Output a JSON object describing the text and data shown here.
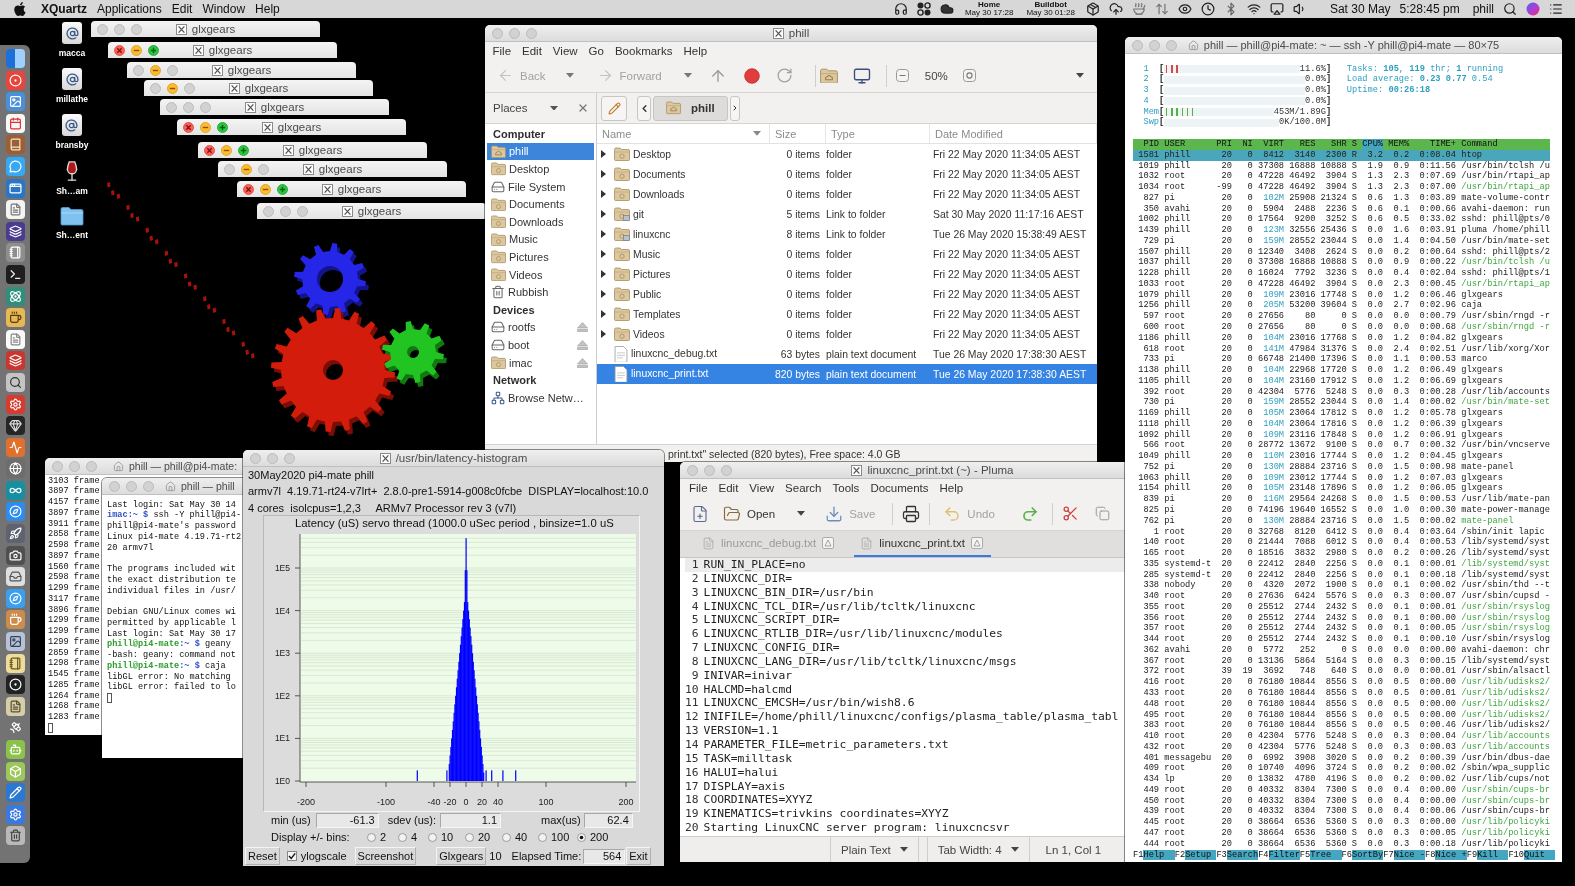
{
  "menubar": {
    "app": "XQuartz",
    "menus": [
      "Applications",
      "Edit",
      "Window",
      "Help"
    ],
    "clocks": [
      {
        "label": "Home",
        "time": "May 30 17:28"
      },
      {
        "label": "Buildbot",
        "time": "May 30 01:28"
      }
    ],
    "date": "Sat 30 May",
    "time": "5:28:45 pm",
    "user": "phill"
  },
  "desktop_icons": [
    {
      "label": "macca",
      "kind": "server"
    },
    {
      "label": "millathe",
      "kind": "server"
    },
    {
      "label": "bransby",
      "kind": "server"
    },
    {
      "label": "Sh…am",
      "kind": "wine"
    },
    {
      "label": "Sh…ent",
      "kind": "folder"
    }
  ],
  "glxgears_windows": [
    {
      "title": "glxgears",
      "lit": [
        false,
        false,
        false
      ]
    },
    {
      "title": "glxgears",
      "lit": [
        true,
        true,
        true
      ]
    },
    {
      "title": "glxgears",
      "lit": [
        false,
        true,
        false
      ]
    },
    {
      "title": "glxgears",
      "lit": [
        false,
        true,
        false
      ]
    },
    {
      "title": "glxgears",
      "lit": [
        false,
        false,
        false
      ]
    },
    {
      "title": "glxgears",
      "lit": [
        true,
        true,
        true
      ]
    },
    {
      "title": "glxgears",
      "lit": [
        true,
        true,
        true
      ]
    },
    {
      "title": "glxgears",
      "lit": [
        false,
        true,
        false
      ]
    },
    {
      "title": "glxgears",
      "lit": [
        true,
        true,
        true
      ]
    },
    {
      "title": "glxgears",
      "lit": [
        false,
        false,
        false
      ]
    }
  ],
  "file_manager": {
    "title": "phill",
    "menus": [
      "File",
      "Edit",
      "View",
      "Go",
      "Bookmarks",
      "Help"
    ],
    "back": {
      "label": "Back",
      "disabled": true
    },
    "forward": {
      "label": "Forward",
      "disabled": true
    },
    "zoom": "50%",
    "places": "Places",
    "path": "phill",
    "sidebar": [
      {
        "heading": "Computer",
        "items": [
          {
            "label": "phill",
            "kind": "home",
            "selected": true
          },
          {
            "label": "Desktop",
            "kind": "folder",
            "selected": false
          },
          {
            "label": "File System",
            "kind": "drive",
            "selected": false
          },
          {
            "label": "Documents",
            "kind": "folder",
            "selected": false
          },
          {
            "label": "Downloads",
            "kind": "folder",
            "selected": false
          },
          {
            "label": "Music",
            "kind": "folder",
            "selected": false
          },
          {
            "label": "Pictures",
            "kind": "folder",
            "selected": false
          },
          {
            "label": "Videos",
            "kind": "folder",
            "selected": false
          },
          {
            "label": "Rubbish",
            "kind": "trash",
            "selected": false
          }
        ]
      },
      {
        "heading": "Devices",
        "items": [
          {
            "label": "rootfs",
            "kind": "drive",
            "eject": true,
            "selected": false
          },
          {
            "label": "boot",
            "kind": "drive",
            "eject": true,
            "selected": false
          },
          {
            "label": "imac",
            "kind": "folder",
            "eject": true,
            "selected": false
          }
        ]
      },
      {
        "heading": "Network",
        "items": [
          {
            "label": "Browse Netw…",
            "kind": "network",
            "selected": false
          }
        ]
      }
    ],
    "columns": [
      {
        "label": "Name",
        "sorted": true
      },
      {
        "label": "Size",
        "sorted": false
      },
      {
        "label": "Type",
        "sorted": false
      },
      {
        "label": "Date Modified",
        "sorted": false
      }
    ],
    "files": [
      {
        "name": "Desktop",
        "size": "0 items",
        "type": "folder",
        "modified": "Fri 22 May 2020 11:34:05 AEST",
        "kind": "folder",
        "expandable": true,
        "selected": false
      },
      {
        "name": "Documents",
        "size": "0 items",
        "type": "folder",
        "modified": "Fri 22 May 2020 11:34:05 AEST",
        "kind": "folder",
        "expandable": true,
        "selected": false
      },
      {
        "name": "Downloads",
        "size": "0 items",
        "type": "folder",
        "modified": "Fri 22 May 2020 11:34:05 AEST",
        "kind": "folder",
        "expandable": true,
        "selected": false
      },
      {
        "name": "git",
        "size": "5 items",
        "type": "Link to folder",
        "modified": "Sat 30 May 2020 11:17:16 AEST",
        "kind": "link",
        "expandable": true,
        "selected": false
      },
      {
        "name": "linuxcnc",
        "size": "8 items",
        "type": "Link to folder",
        "modified": "Tue 26 May 2020 15:38:49 AEST",
        "kind": "link",
        "expandable": true,
        "selected": false
      },
      {
        "name": "Music",
        "size": "0 items",
        "type": "folder",
        "modified": "Fri 22 May 2020 11:34:05 AEST",
        "kind": "folder",
        "expandable": true,
        "selected": false
      },
      {
        "name": "Pictures",
        "size": "0 items",
        "type": "folder",
        "modified": "Fri 22 May 2020 11:34:05 AEST",
        "kind": "folder",
        "expandable": true,
        "selected": false
      },
      {
        "name": "Public",
        "size": "0 items",
        "type": "folder",
        "modified": "Fri 22 May 2020 11:34:05 AEST",
        "kind": "folder",
        "expandable": true,
        "selected": false
      },
      {
        "name": "Templates",
        "size": "0 items",
        "type": "folder",
        "modified": "Fri 22 May 2020 11:34:05 AEST",
        "kind": "folder",
        "expandable": true,
        "selected": false
      },
      {
        "name": "Videos",
        "size": "0 items",
        "type": "folder",
        "modified": "Fri 22 May 2020 11:34:05 AEST",
        "kind": "folder",
        "expandable": true,
        "selected": false
      },
      {
        "name": "linuxcnc_debug.txt",
        "size": "63 bytes",
        "type": "plain text document",
        "modified": "Tue 26 May 2020 17:38:30 AEST",
        "kind": "text",
        "expandable": false,
        "selected": false
      },
      {
        "name": "linuxcnc_print.txt",
        "size": "820 bytes",
        "type": "plain text document",
        "modified": "Tue 26 May 2020 17:38:30 AEST",
        "kind": "text",
        "expandable": false,
        "selected": true
      }
    ],
    "status": "print.txt\" selected (820 bytes), Free space: 4.0 GB"
  },
  "terminals": [
    {
      "title": "phill — phill@pi4-mate:",
      "blocks": [
        [
          {
            "text": "3103 frame"
          },
          {
            "text": "3897 frame"
          },
          {
            "text": "4157 frame"
          },
          {
            "text": "3897 frame"
          },
          {
            "text": "3911 frame"
          },
          {
            "text": "2858 frame"
          },
          {
            "text": "2598 frame"
          },
          {
            "text": "3897 frame"
          },
          {
            "text": "1560 frame"
          },
          {
            "text": "2598 frame"
          },
          {
            "text": "1299 frame"
          },
          {
            "text": "3117 frame"
          },
          {
            "text": "3896 frame"
          },
          {
            "text": "1299 frame"
          },
          {
            "text": "1299 frame"
          },
          {
            "text": "1299 frame"
          },
          {
            "text": "2859 frame"
          },
          {
            "text": "1298 frame"
          },
          {
            "text": "1545 frame"
          },
          {
            "text": "1285 frame"
          },
          {
            "text": "1264 frame"
          },
          {
            "text": "1268 frame"
          },
          {
            "text": "1283 frame"
          }
        ]
      ]
    },
    {
      "title": "phill — phill",
      "blocks": [
        [
          {
            "text": "Last login: Sat May 30 14"
          },
          {
            "prompt": "imac:~ $ ",
            "text": "ssh -Y phill@pi4-"
          },
          {
            "text": "phill@pi4-mate's password"
          },
          {
            "text": "Linux pi4-mate 4.19.71-rt2"
          },
          {
            "text": "20 armv7l"
          }
        ],
        [
          {
            "text": "The programs included wit"
          },
          {
            "text": "the exact distribution te"
          },
          {
            "text": "individual files in /usr/"
          }
        ],
        [
          {
            "text": "Debian GNU/Linux comes wi"
          },
          {
            "text": "permitted by applicable l"
          },
          {
            "text": "Last login: Sat May 30 17"
          },
          {
            "user": "phill@pi4-mate",
            "prompt": ":~ $ ",
            "text": "geany"
          },
          {
            "text": "-bash: geany: command not"
          },
          {
            "user": "phill@pi4-mate",
            "prompt": ":~ $ ",
            "text": "caja"
          },
          {
            "text": "libGL error: No matching"
          },
          {
            "text": "libGL error: failed to lo"
          }
        ]
      ]
    }
  ],
  "latency": {
    "title": "/usr/bin/latency-histogram",
    "info": [
      "30May2020 pi4-mate phill",
      "armv7l  4.19.71-rt24-v7lrt+  2.8.0-pre1-5914-g008c0fcbe  DISPLAY=localhost:10.0",
      "4 cores  isolcpus=1,2,3     ARMv7 Processor rev 3 (v7l)"
    ],
    "chart": {
      "title": "Latency (uS) servo thread (1000.0 uSec period , binsize=1.0 uS",
      "y_labels": [
        "1E5",
        "1E4",
        "1E3",
        "1E2",
        "1E1",
        "1E0"
      ],
      "x_labels": [
        "-200",
        "-100",
        "-40",
        "-20",
        "0",
        "20",
        "40",
        "100",
        "200"
      ]
    },
    "stats": [
      {
        "label": "min (us)",
        "value": "-61.3"
      },
      {
        "label": "sdev (us):",
        "value": "1.1"
      },
      {
        "label": "max(us)",
        "value": "62.4"
      }
    ],
    "bins": {
      "label": "Display +/- bins:",
      "options": [
        {
          "label": "2",
          "selected": false
        },
        {
          "label": "4",
          "selected": false
        },
        {
          "label": "10",
          "selected": false
        },
        {
          "label": "20",
          "selected": false
        },
        {
          "label": "40",
          "selected": false
        },
        {
          "label": "100",
          "selected": false
        },
        {
          "label": "200",
          "selected": true
        }
      ]
    },
    "controls_row": [
      {
        "kind": "button",
        "label": "Reset"
      },
      {
        "kind": "checkbox",
        "label": "ylogscale",
        "checked": true
      },
      {
        "kind": "button",
        "label": "Screenshot"
      },
      {
        "kind": "button",
        "label": "Glxgears"
      },
      {
        "kind": "text",
        "label": "10"
      },
      {
        "kind": "text",
        "label": "Elapsed Time:"
      },
      {
        "kind": "field",
        "label": "564"
      },
      {
        "kind": "button",
        "label": "Exit"
      }
    ]
  },
  "pluma": {
    "title": "linuxcnc_print.txt (~) - Pluma",
    "menus": [
      "File",
      "Edit",
      "View",
      "Search",
      "Tools",
      "Documents",
      "Help"
    ],
    "toolbar": {
      "open": {
        "label": "Open",
        "disabled": false
      },
      "save": {
        "label": "Save",
        "disabled": true
      },
      "undo": {
        "label": "Undo",
        "disabled": true
      }
    },
    "tabs": [
      {
        "label": "linuxcnc_debug.txt",
        "selected": false
      },
      {
        "label": "linuxcnc_print.txt",
        "selected": true
      }
    ],
    "lines": [
      {
        "number": "1",
        "text": "RUN_IN_PLACE=no",
        "current": true
      },
      {
        "number": "2",
        "text": "LINUXCNC_DIR=",
        "current": false
      },
      {
        "number": "3",
        "text": "LINUXCNC_BIN_DIR=/usr/bin",
        "current": false
      },
      {
        "number": "4",
        "text": "LINUXCNC_TCL_DIR=/usr/lib/tcltk/linuxcnc",
        "current": false
      },
      {
        "number": "5",
        "text": "LINUXCNC_SCRIPT_DIR=",
        "current": false
      },
      {
        "number": "6",
        "text": "LINUXCNC_RTLIB_DIR=/usr/lib/linuxcnc/modules",
        "current": false
      },
      {
        "number": "7",
        "text": "LINUXCNC_CONFIG_DIR=",
        "current": false
      },
      {
        "number": "8",
        "text": "LINUXCNC_LANG_DIR=/usr/lib/tcltk/linuxcnc/msgs",
        "current": false
      },
      {
        "number": "9",
        "text": "INIVAR=inivar",
        "current": false
      },
      {
        "number": "10",
        "text": "HALCMD=halcmd",
        "current": false
      },
      {
        "number": "11",
        "text": "LINUXCNC_EMCSH=/usr/bin/wish8.6",
        "current": false
      },
      {
        "number": "12",
        "text": "INIFILE=/home/phill/linuxcnc/configs/plasma_table/plasma_tabl",
        "current": false
      },
      {
        "number": "13",
        "text": "VERSION=1.1",
        "current": false
      },
      {
        "number": "14",
        "text": "PARAMETER_FILE=metric_parameters.txt",
        "current": false
      },
      {
        "number": "15",
        "text": "TASK=milltask",
        "current": false
      },
      {
        "number": "16",
        "text": "HALUI=halui",
        "current": false
      },
      {
        "number": "17",
        "text": "DISPLAY=axis",
        "current": false
      },
      {
        "number": "18",
        "text": "COORDINATES=XYYZ",
        "current": false
      },
      {
        "number": "19",
        "text": "KINEMATICS=trivkins coordinates=XYYZ",
        "current": false
      },
      {
        "number": "20",
        "text": "Starting LinuxCNC server program: linuxcncsvr",
        "current": false
      }
    ],
    "status": {
      "language": "Plain Text",
      "tab_width": "Tab Width: 4",
      "position": "Ln 1, Col 1"
    }
  },
  "htop": {
    "title": "phill — phill@pi4-mate: ~ — ssh -Y phill@pi4-mate — 80×75",
    "cpu_meters": [
      {
        "label": "1",
        "open": "[",
        "level": 0.116,
        "reading": "11.6%",
        "close": "]"
      },
      {
        "label": "2",
        "open": "[",
        "reading": "0.0%",
        "close": "]"
      },
      {
        "label": "3",
        "open": "[",
        "reading": "0.0%",
        "close": "]"
      },
      {
        "label": "4",
        "open": "[",
        "reading": "0.0%",
        "close": "]"
      }
    ],
    "memory_meters": [
      {
        "label": "Mem",
        "open": "[",
        "level": 0.27,
        "reading": "453M/1.89G",
        "close": "]"
      },
      {
        "label": "Swp",
        "open": "[",
        "reading": "0K/100.0M",
        "close": "]"
      }
    ],
    "summary": [
      "Tasks: **105**, **119** thr; **1** running",
      "Load average: **0.23** **0.77** 0.54",
      "Uptime: **00:26:18**"
    ],
    "columns": [
      {
        "label": "PID",
        "sorted": false
      },
      {
        "label": "USER",
        "sorted": false
      },
      {
        "label": "PRI",
        "sorted": false
      },
      {
        "label": "NI",
        "sorted": false
      },
      {
        "label": "VIRT",
        "sorted": false
      },
      {
        "label": "RES",
        "sorted": false
      },
      {
        "label": "SHR",
        "sorted": false
      },
      {
        "label": "S",
        "sorted": false
      },
      {
        "label": "CPU%",
        "sorted": true
      },
      {
        "label": "MEM%",
        "sorted": false
      },
      {
        "label": "TIME+",
        "sorted": false
      },
      {
        "label": "Command",
        "sorted": false
      }
    ],
    "rows": [
      {
        "cells": [
          "1581",
          "phill",
          "20",
          "0",
          "8412",
          "3140",
          "2300",
          "R",
          "3.2",
          "0.2",
          "0:08.04",
          "htop"
        ],
        "thread": false,
        "selected": true
      },
      {
        "cells": [
          "1019",
          "phill",
          "20",
          "0",
          "37308",
          "16888",
          "10888",
          "S",
          "1.9",
          "0.9",
          "0:11.56",
          "/usr/bin/tclsh /u"
        ],
        "thread": false,
        "selected": false
      },
      {
        "cells": [
          "1032",
          "root",
          "20",
          "0",
          "47228",
          "46492",
          "3904",
          "S",
          "1.3",
          "2.3",
          "0:07.69",
          "/usr/bin/rtapi_ap"
        ],
        "thread": false,
        "selected": false
      },
      {
        "cells": [
          "1034",
          "root",
          "-99",
          "0",
          "47228",
          "46492",
          "3904",
          "S",
          "1.3",
          "2.3",
          "0:07.00",
          "/usr/bin/rtapi_ap"
        ],
        "thread": true,
        "selected": false
      },
      {
        "cells": [
          "827",
          "pi",
          "20",
          "0",
          "102M",
          "25908",
          "21324",
          "S",
          "0.6",
          "1.3",
          "0:03.89",
          "mate-volume-contr"
        ],
        "thread": false,
        "selected": false
      },
      {
        "cells": [
          "350",
          "avahi",
          "20",
          "0",
          "5904",
          "2488",
          "2236",
          "S",
          "0.6",
          "0.1",
          "0:00.66",
          "avahi-daemon: run"
        ],
        "thread": false,
        "selected": false
      },
      {
        "cells": [
          "1002",
          "phill",
          "20",
          "0",
          "17564",
          "9200",
          "3252",
          "S",
          "0.6",
          "0.5",
          "0:33.02",
          "sshd: phill@pts/0"
        ],
        "thread": false,
        "selected": false
      },
      {
        "cells": [
          "1439",
          "phill",
          "20",
          "0",
          "123M",
          "32556",
          "25436",
          "S",
          "0.0",
          "1.6",
          "0:03.91",
          "pluma /home/phill"
        ],
        "thread": false,
        "selected": false
      },
      {
        "cells": [
          "729",
          "pi",
          "20",
          "0",
          "159M",
          "28552",
          "23044",
          "S",
          "0.0",
          "1.4",
          "0:04.50",
          "/usr/bin/mate-set"
        ],
        "thread": false,
        "selected": false
      },
      {
        "cells": [
          "1507",
          "phill",
          "20",
          "0",
          "12340",
          "3408",
          "2624",
          "S",
          "0.0",
          "0.2",
          "0:00.64",
          "sshd: phill@pts/2"
        ],
        "thread": false,
        "selected": false
      },
      {
        "cells": [
          "1037",
          "phill",
          "20",
          "0",
          "37308",
          "16888",
          "10888",
          "S",
          "0.0",
          "0.9",
          "0:00.22",
          "/usr/bin/tclsh /u"
        ],
        "thread": true,
        "selected": false
      },
      {
        "cells": [
          "1228",
          "phill",
          "20",
          "0",
          "16024",
          "7792",
          "3236",
          "S",
          "0.0",
          "0.4",
          "0:02.04",
          "sshd: phill@pts/1"
        ],
        "thread": false,
        "selected": false
      },
      {
        "cells": [
          "1033",
          "root",
          "20",
          "0",
          "47228",
          "46492",
          "3904",
          "S",
          "0.0",
          "2.3",
          "0:00.45",
          "/usr/bin/rtapi_ap"
        ],
        "thread": true,
        "selected": false
      },
      {
        "cells": [
          "1079",
          "phill",
          "20",
          "0",
          "109M",
          "23016",
          "17748",
          "S",
          "0.0",
          "1.2",
          "0:06.46",
          "glxgears"
        ],
        "thread": false,
        "selected": false
      },
      {
        "cells": [
          "1256",
          "phill",
          "20",
          "0",
          "205M",
          "53200",
          "39604",
          "S",
          "0.0",
          "2.7",
          "0:02.96",
          "caja"
        ],
        "thread": false,
        "selected": false
      },
      {
        "cells": [
          "597",
          "root",
          "20",
          "0",
          "27656",
          "80",
          "0",
          "S",
          "0.0",
          "0.0",
          "0:00.79",
          "/usr/sbin/rngd -r"
        ],
        "thread": false,
        "selected": false
      },
      {
        "cells": [
          "600",
          "root",
          "20",
          "0",
          "27656",
          "80",
          "0",
          "S",
          "0.0",
          "0.0",
          "0:00.68",
          "/usr/sbin/rngd -r"
        ],
        "thread": true,
        "selected": false
      },
      {
        "cells": [
          "1186",
          "phill",
          "20",
          "0",
          "104M",
          "23016",
          "17768",
          "S",
          "0.0",
          "1.2",
          "0:04.82",
          "glxgears"
        ],
        "thread": false,
        "selected": false
      },
      {
        "cells": [
          "618",
          "root",
          "20",
          "0",
          "141M",
          "47984",
          "31376",
          "S",
          "0.0",
          "2.4",
          "0:02.51",
          "/usr/lib/xorg/Xor"
        ],
        "thread": false,
        "selected": false
      },
      {
        "cells": [
          "733",
          "pi",
          "20",
          "0",
          "66748",
          "21400",
          "17396",
          "S",
          "0.0",
          "1.1",
          "0:00.53",
          "marco"
        ],
        "thread": false,
        "selected": false
      },
      {
        "cells": [
          "1138",
          "phill",
          "20",
          "0",
          "104M",
          "22968",
          "17720",
          "S",
          "0.0",
          "1.2",
          "0:06.49",
          "glxgears"
        ],
        "thread": false,
        "selected": false
      },
      {
        "cells": [
          "1105",
          "phill",
          "20",
          "0",
          "104M",
          "23160",
          "17912",
          "S",
          "0.0",
          "1.2",
          "0:06.69",
          "glxgears"
        ],
        "thread": false,
        "selected": false
      },
      {
        "cells": [
          "392",
          "root",
          "20",
          "0",
          "42304",
          "5776",
          "5248",
          "S",
          "0.0",
          "0.3",
          "0:00.28",
          "/usr/lib/accounts"
        ],
        "thread": false,
        "selected": false
      },
      {
        "cells": [
          "730",
          "pi",
          "20",
          "0",
          "159M",
          "28552",
          "23044",
          "S",
          "0.0",
          "1.4",
          "0:00.02",
          "/usr/bin/mate-set"
        ],
        "thread": true,
        "selected": false
      },
      {
        "cells": [
          "1169",
          "phill",
          "20",
          "0",
          "105M",
          "23064",
          "17812",
          "S",
          "0.0",
          "1.2",
          "0:05.78",
          "glxgears"
        ],
        "thread": false,
        "selected": false
      },
      {
        "cells": [
          "1118",
          "phill",
          "20",
          "0",
          "104M",
          "23064",
          "17816",
          "S",
          "0.0",
          "1.2",
          "0:06.39",
          "glxgears"
        ],
        "thread": false,
        "selected": false
      },
      {
        "cells": [
          "1092",
          "phill",
          "20",
          "0",
          "109M",
          "23116",
          "17848",
          "S",
          "0.0",
          "1.2",
          "0:06.91",
          "glxgears"
        ],
        "thread": false,
        "selected": false
      },
      {
        "cells": [
          "566",
          "root",
          "20",
          "0",
          "28772",
          "13672",
          "9100",
          "S",
          "0.0",
          "0.7",
          "0:00.32",
          "/usr/bin/vncserve"
        ],
        "thread": false,
        "selected": false
      },
      {
        "cells": [
          "1049",
          "phill",
          "20",
          "0",
          "110M",
          "23016",
          "17744",
          "S",
          "0.0",
          "1.2",
          "0:04.45",
          "glxgears"
        ],
        "thread": false,
        "selected": false
      },
      {
        "cells": [
          "752",
          "pi",
          "20",
          "0",
          "130M",
          "28884",
          "23716",
          "S",
          "0.0",
          "1.5",
          "0:00.98",
          "mate-panel"
        ],
        "thread": false,
        "selected": false
      },
      {
        "cells": [
          "1063",
          "phill",
          "20",
          "0",
          "109M",
          "23012",
          "17744",
          "S",
          "0.0",
          "1.2",
          "0:07.03",
          "glxgears"
        ],
        "thread": false,
        "selected": false
      },
      {
        "cells": [
          "1154",
          "phill",
          "20",
          "0",
          "105M",
          "23148",
          "17896",
          "S",
          "0.0",
          "1.2",
          "0:06.05",
          "glxgears"
        ],
        "thread": false,
        "selected": false
      },
      {
        "cells": [
          "839",
          "pi",
          "20",
          "0",
          "116M",
          "29564",
          "24268",
          "S",
          "0.0",
          "1.5",
          "0:00.53",
          "/usr/lib/mate-pan"
        ],
        "thread": false,
        "selected": false
      },
      {
        "cells": [
          "825",
          "pi",
          "20",
          "0",
          "74196",
          "19640",
          "16552",
          "S",
          "0.0",
          "1.0",
          "0:00.30",
          "mate-power-manage"
        ],
        "thread": false,
        "selected": false
      },
      {
        "cells": [
          "762",
          "pi",
          "20",
          "0",
          "130M",
          "28884",
          "23716",
          "S",
          "0.0",
          "1.5",
          "0:00.02",
          "mate-panel"
        ],
        "thread": true,
        "selected": false
      },
      {
        "cells": [
          "1",
          "root",
          "20",
          "0",
          "32768",
          "8120",
          "6412",
          "S",
          "0.0",
          "0.4",
          "0:03.64",
          "/sbin/init lapic"
        ],
        "thread": false,
        "selected": false
      },
      {
        "cells": [
          "140",
          "root",
          "20",
          "0",
          "21444",
          "7088",
          "6012",
          "S",
          "0.0",
          "0.4",
          "0:00.53",
          "/lib/systemd/syst"
        ],
        "thread": false,
        "selected": false
      },
      {
        "cells": [
          "165",
          "root",
          "20",
          "0",
          "18516",
          "3832",
          "2980",
          "S",
          "0.0",
          "0.2",
          "0:00.26",
          "/lib/systemd/syst"
        ],
        "thread": false,
        "selected": false
      },
      {
        "cells": [
          "335",
          "systemd-t",
          "20",
          "0",
          "22412",
          "2840",
          "2256",
          "S",
          "0.0",
          "0.1",
          "0:00.01",
          "/lib/systemd/syst"
        ],
        "thread": true,
        "selected": false
      },
      {
        "cells": [
          "285",
          "systemd-t",
          "20",
          "0",
          "22412",
          "2840",
          "2256",
          "S",
          "0.0",
          "0.1",
          "0:00.18",
          "/lib/systemd/syst"
        ],
        "thread": false,
        "selected": false
      },
      {
        "cells": [
          "338",
          "nobody",
          "20",
          "0",
          "4320",
          "2072",
          "1900",
          "S",
          "0.0",
          "0.1",
          "0:00.02",
          "/usr/sbin/thd --t"
        ],
        "thread": false,
        "selected": false
      },
      {
        "cells": [
          "340",
          "root",
          "20",
          "0",
          "27636",
          "6424",
          "5576",
          "S",
          "0.0",
          "0.3",
          "0:00.07",
          "/usr/sbin/cupsd -"
        ],
        "thread": false,
        "selected": false
      },
      {
        "cells": [
          "355",
          "root",
          "20",
          "0",
          "25512",
          "2744",
          "2432",
          "S",
          "0.0",
          "0.1",
          "0:00.01",
          "/usr/sbin/rsyslog"
        ],
        "thread": true,
        "selected": false
      },
      {
        "cells": [
          "356",
          "root",
          "20",
          "0",
          "25512",
          "2744",
          "2432",
          "S",
          "0.0",
          "0.1",
          "0:00.00",
          "/usr/sbin/rsyslog"
        ],
        "thread": true,
        "selected": false
      },
      {
        "cells": [
          "357",
          "root",
          "20",
          "0",
          "25512",
          "2744",
          "2432",
          "S",
          "0.0",
          "0.1",
          "0:00.05",
          "/usr/sbin/rsyslog"
        ],
        "thread": true,
        "selected": false
      },
      {
        "cells": [
          "344",
          "root",
          "20",
          "0",
          "25512",
          "2744",
          "2432",
          "S",
          "0.0",
          "0.1",
          "0:00.10",
          "/usr/sbin/rsyslog"
        ],
        "thread": false,
        "selected": false
      },
      {
        "cells": [
          "362",
          "avahi",
          "20",
          "0",
          "5772",
          "252",
          "0",
          "S",
          "0.0",
          "0.0",
          "0:00.00",
          "avahi-daemon: chr"
        ],
        "thread": false,
        "selected": false
      },
      {
        "cells": [
          "367",
          "root",
          "20",
          "0",
          "13136",
          "5864",
          "5164",
          "S",
          "0.0",
          "0.3",
          "0:00.15",
          "/lib/systemd/syst"
        ],
        "thread": false,
        "selected": false
      },
      {
        "cells": [
          "372",
          "root",
          "39",
          "19",
          "3692",
          "748",
          "640",
          "S",
          "0.0",
          "0.0",
          "0:00.01",
          "/usr/sbin/alsactl"
        ],
        "thread": false,
        "selected": false
      },
      {
        "cells": [
          "416",
          "root",
          "20",
          "0",
          "76180",
          "10844",
          "8556",
          "S",
          "0.0",
          "0.5",
          "0:00.00",
          "/usr/lib/udisks2/"
        ],
        "thread": true,
        "selected": false
      },
      {
        "cells": [
          "433",
          "root",
          "20",
          "0",
          "76180",
          "10844",
          "8556",
          "S",
          "0.0",
          "0.5",
          "0:00.01",
          "/usr/lib/udisks2/"
        ],
        "thread": true,
        "selected": false
      },
      {
        "cells": [
          "448",
          "root",
          "20",
          "0",
          "76180",
          "10844",
          "8556",
          "S",
          "0.0",
          "0.5",
          "0:00.00",
          "/usr/lib/udisks2/"
        ],
        "thread": true,
        "selected": false
      },
      {
        "cells": [
          "495",
          "root",
          "20",
          "0",
          "76180",
          "10844",
          "8556",
          "S",
          "0.0",
          "0.5",
          "0:00.00",
          "/usr/lib/udisks2/"
        ],
        "thread": true,
        "selected": false
      },
      {
        "cells": [
          "383",
          "root",
          "20",
          "0",
          "76180",
          "10844",
          "8556",
          "S",
          "0.0",
          "0.5",
          "0:00.46",
          "/usr/lib/udisks2/"
        ],
        "thread": false,
        "selected": false
      },
      {
        "cells": [
          "410",
          "root",
          "20",
          "0",
          "42304",
          "5776",
          "5248",
          "S",
          "0.0",
          "0.3",
          "0:00.04",
          "/usr/lib/accounts"
        ],
        "thread": true,
        "selected": false
      },
      {
        "cells": [
          "432",
          "root",
          "20",
          "0",
          "42304",
          "5776",
          "5248",
          "S",
          "0.0",
          "0.3",
          "0:00.03",
          "/usr/lib/accounts"
        ],
        "thread": true,
        "selected": false
      },
      {
        "cells": [
          "401",
          "messagebu",
          "20",
          "0",
          "6992",
          "3908",
          "3020",
          "S",
          "0.0",
          "0.2",
          "0:00.39",
          "/usr/bin/dbus-dae"
        ],
        "thread": false,
        "selected": false
      },
      {
        "cells": [
          "409",
          "root",
          "20",
          "0",
          "10740",
          "4096",
          "3724",
          "S",
          "0.0",
          "0.2",
          "0:00.02",
          "/sbin/wpa_supplic"
        ],
        "thread": false,
        "selected": false
      },
      {
        "cells": [
          "434",
          "lp",
          "20",
          "0",
          "13832",
          "4780",
          "4196",
          "S",
          "0.0",
          "0.2",
          "0:00.02",
          "/usr/lib/cups/not"
        ],
        "thread": false,
        "selected": false
      },
      {
        "cells": [
          "449",
          "root",
          "20",
          "0",
          "40332",
          "8304",
          "7300",
          "S",
          "0.0",
          "0.4",
          "0:00.00",
          "/usr/sbin/cups-br"
        ],
        "thread": true,
        "selected": false
      },
      {
        "cells": [
          "450",
          "root",
          "20",
          "0",
          "40332",
          "8304",
          "7300",
          "S",
          "0.0",
          "0.4",
          "0:00.00",
          "/usr/sbin/cups-br"
        ],
        "thread": true,
        "selected": false
      },
      {
        "cells": [
          "439",
          "root",
          "20",
          "0",
          "40332",
          "8304",
          "7300",
          "S",
          "0.0",
          "0.4",
          "0:00.06",
          "/usr/sbin/cups-br"
        ],
        "thread": false,
        "selected": false
      },
      {
        "cells": [
          "445",
          "root",
          "20",
          "0",
          "38664",
          "6536",
          "5360",
          "S",
          "0.0",
          "0.3",
          "0:00.00",
          "/usr/lib/policyki"
        ],
        "thread": true,
        "selected": false
      },
      {
        "cells": [
          "447",
          "root",
          "20",
          "0",
          "38664",
          "6536",
          "5360",
          "S",
          "0.0",
          "0.3",
          "0:00.05",
          "/usr/lib/policyki"
        ],
        "thread": true,
        "selected": false
      },
      {
        "cells": [
          "444",
          "root",
          "20",
          "0",
          "38664",
          "6536",
          "5360",
          "S",
          "0.0",
          "0.3",
          "0:00.18",
          "/usr/lib/policyki"
        ],
        "thread": false,
        "selected": false
      }
    ],
    "keys": [
      {
        "key": "F1",
        "label": "Help"
      },
      {
        "key": "F2",
        "label": "Setup"
      },
      {
        "key": "F3",
        "label": "Search"
      },
      {
        "key": "F4",
        "label": "Filter"
      },
      {
        "key": "F5",
        "label": "Tree"
      },
      {
        "key": "F6",
        "label": "SortBy"
      },
      {
        "key": "F7",
        "label": "Nice -"
      },
      {
        "key": "F8",
        "label": "Nice +"
      },
      {
        "key": "F9",
        "label": "Kill"
      },
      {
        "key": "F10",
        "label": "Quit"
      }
    ]
  }
}
